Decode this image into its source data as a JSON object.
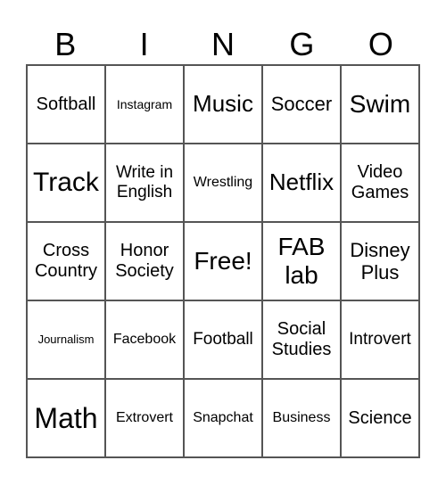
{
  "header": [
    "B",
    "I",
    "N",
    "G",
    "O"
  ],
  "cells": [
    "Softball",
    "Instagram",
    "Music",
    "Soccer",
    "Swim",
    "Track",
    "Write in English",
    "Wrestling",
    "Netflix",
    "Video Games",
    "Cross Country",
    "Honor Society",
    "Free!",
    "FAB lab",
    "Disney Plus",
    "Journalism",
    "Facebook",
    "Football",
    "Social Studies",
    "Introvert",
    "Math",
    "Extrovert",
    "Snapchat",
    "Business",
    "Science"
  ]
}
